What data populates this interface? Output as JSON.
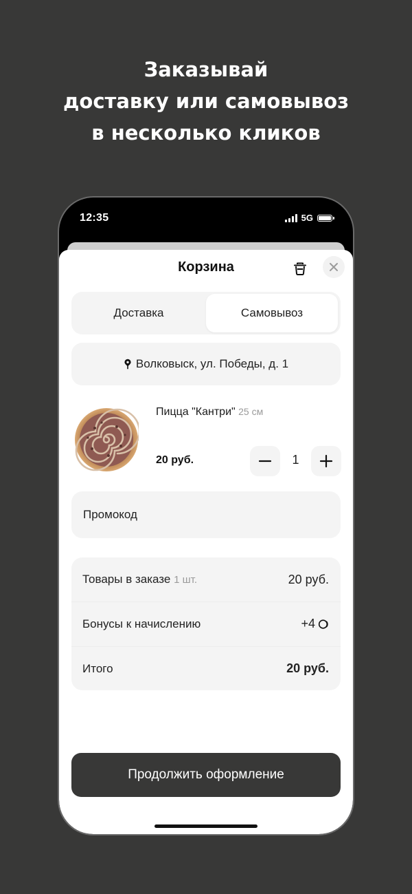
{
  "headline": {
    "line1": "Заказывай",
    "line2": "доставку или самовывоз",
    "line3": "в несколько кликов"
  },
  "status_bar": {
    "time": "12:35",
    "network": "5G"
  },
  "cart": {
    "title": "Корзина",
    "tabs": [
      {
        "label": "Доставка",
        "selected": false
      },
      {
        "label": "Самовывоз",
        "selected": true
      }
    ],
    "address": "Волковыск, ул. Победы, д. 1",
    "item": {
      "name": "Пицца \"Кантри\"",
      "size": "25 см",
      "price": "20 руб.",
      "quantity": "1"
    },
    "promo_label": "Промокод",
    "summary": {
      "items_label": "Товары в заказе",
      "items_count": "1 шт.",
      "items_value": "20 руб.",
      "bonus_label": "Бонусы к начислению",
      "bonus_value": "+4",
      "total_label": "Итого",
      "total_value": "20 руб."
    },
    "continue_label": "Продолжить оформление"
  },
  "colors": {
    "background": "#383837",
    "accent_button": "#383837",
    "card": "#f4f4f4"
  }
}
